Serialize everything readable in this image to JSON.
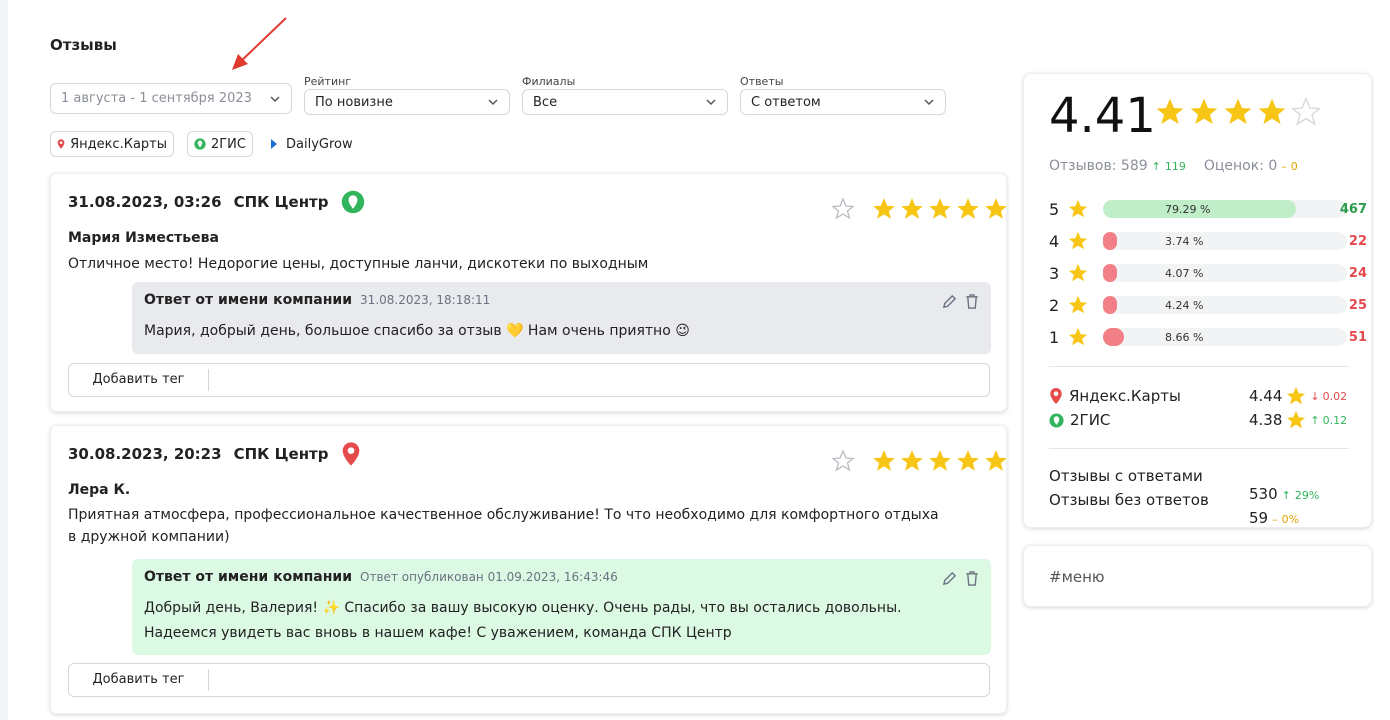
{
  "page": {
    "title": "Отзывы"
  },
  "filters": {
    "date": {
      "value": "1 августа - 1 сентября 2023"
    },
    "rating": {
      "label": "Рейтинг",
      "value": "По новизне"
    },
    "branches": {
      "label": "Филиалы",
      "value": "Все"
    },
    "answers": {
      "label": "Ответы",
      "value": "С ответом"
    }
  },
  "sources": [
    {
      "label": "Яндекс.Карты",
      "icon": "yandex-pin-icon"
    },
    {
      "label": "2ГИС",
      "icon": "2gis-icon"
    },
    {
      "label": "DailyGrow",
      "icon": "chevron-right-icon"
    }
  ],
  "reviews": [
    {
      "datetime": "31.08.2023, 03:26",
      "branch": "СПК Центр",
      "platform_icon": "2gis-icon",
      "rating": 5,
      "author": "Мария Изместьева",
      "text": "Отличное место! Недорогие цены, доступные ланчи, дискотеки по выходным",
      "reply": {
        "title": "Ответ от имени компании",
        "meta": "31.08.2023, 18:18:11",
        "text": "Мария, добрый день, большое спасибо за отзыв 💛 Нам очень приятно 😉",
        "status_color": "#e9eaee"
      },
      "tag_button": "Добавить тег"
    },
    {
      "datetime": "30.08.2023, 20:23",
      "branch": "СПК Центр",
      "platform_icon": "yandex-pin-icon",
      "rating": 5,
      "author": "Лера К.",
      "text_line1": "Приятная атмосфера, профессиональное качественное обслуживание! То что необходимо для комфортного отдыха",
      "text_line2": "в дружной компании)",
      "reply": {
        "title": "Ответ от имени компании",
        "meta": "Ответ опубликован 01.09.2023, 16:43:46",
        "text_line1": "Добрый день, Валерия! ✨ Спасибо за вашу высокую оценку. Очень рады, что вы остались довольны.",
        "text_line2": "Надеемся увидеть вас вновь в нашем кафе! С уважением, команда СПК Центр",
        "status_color": "#dcf9e4"
      },
      "tag_button": "Добавить тег"
    }
  ],
  "summary": {
    "average": "4.41",
    "average_stars": 4.41,
    "reviews_label": "Отзывов: 589",
    "reviews_delta": "119",
    "ratings_label": "Оценок: 0",
    "ratings_delta": "0",
    "distribution": [
      {
        "stars": "5",
        "pct": "79.29 %",
        "share": 0.7929,
        "count": "467",
        "color": "#bfeec9",
        "count_color": "#2a9d4b"
      },
      {
        "stars": "4",
        "pct": "3.74 %",
        "share": 0.0374,
        "count": "22",
        "color": "#f27f86",
        "count_color": "#e5484d"
      },
      {
        "stars": "3",
        "pct": "4.07 %",
        "share": 0.0407,
        "count": "24",
        "color": "#f27f86",
        "count_color": "#e5484d"
      },
      {
        "stars": "2",
        "pct": "4.24 %",
        "share": 0.0424,
        "count": "25",
        "color": "#f27f86",
        "count_color": "#e5484d"
      },
      {
        "stars": "1",
        "pct": "8.66 %",
        "share": 0.0866,
        "count": "51",
        "color": "#f27f86",
        "count_color": "#e5484d"
      }
    ],
    "platforms": [
      {
        "name": "Яндекс.Карты",
        "icon": "yandex-pin-icon",
        "rating": "4.44",
        "delta": "0.02",
        "direction": "down"
      },
      {
        "name": "2ГИС",
        "icon": "2gis-icon",
        "rating": "4.38",
        "delta": "0.12",
        "direction": "up"
      }
    ],
    "answered": {
      "label": "Отзывы с ответами",
      "value": "530",
      "delta": "29%"
    },
    "unanswered": {
      "label": "Отзывы без ответов",
      "value": "59",
      "delta": "0%"
    }
  },
  "tags_panel": {
    "tag": "#меню"
  },
  "colors": {
    "star": "#f7c516",
    "green": "#31b45b",
    "red": "#e54b4b",
    "accent_arrow": "#e03a2f"
  }
}
